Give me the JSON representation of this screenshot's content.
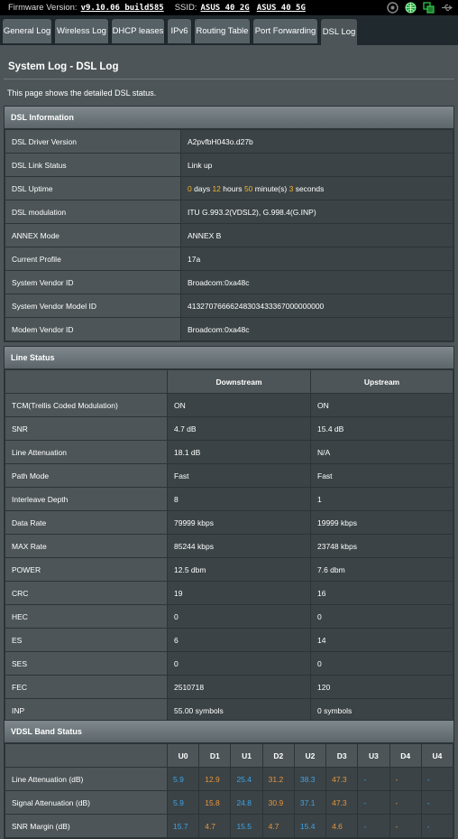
{
  "topbar": {
    "firmware_label": "Firmware Version:",
    "firmware_value": "v9.10.06 build585",
    "ssid_label": "SSID:",
    "ssid_2g": "ASUS_40_2G",
    "ssid_5g": "ASUS_40_5G"
  },
  "tabs": [
    {
      "label": "General Log"
    },
    {
      "label": "Wireless Log"
    },
    {
      "label": "DHCP leases"
    },
    {
      "label": "IPv6"
    },
    {
      "label": "Routing Table"
    },
    {
      "label": "Port Forwarding"
    },
    {
      "label": "DSL Log"
    }
  ],
  "page": {
    "title": "System Log - DSL Log",
    "description": "This page shows the detailed DSL status."
  },
  "dsl_info": {
    "header": "DSL Information",
    "rows": [
      {
        "label": "DSL Driver Version",
        "value": "A2pvfbH043o.d27b"
      },
      {
        "label": "DSL Link Status",
        "value": "Link up"
      },
      {
        "label": "DSL Uptime",
        "value": ""
      },
      {
        "label": "DSL modulation",
        "value": "ITU G.993.2(VDSL2), G.998.4(G.INP)"
      },
      {
        "label": "ANNEX Mode",
        "value": "ANNEX B"
      },
      {
        "label": "Current Profile",
        "value": "17a"
      },
      {
        "label": "System Vendor ID",
        "value": "Broadcom:0xa48c"
      },
      {
        "label": "System Vendor Model ID",
        "value": "41327076666248303433367000000000"
      },
      {
        "label": "Modem Vendor ID",
        "value": "Broadcom:0xa48c"
      }
    ],
    "uptime": {
      "days": "0",
      "days_label": "days",
      "hours": "12",
      "hours_label": "hours",
      "minutes": "50",
      "minutes_label": "minute(s)",
      "seconds": "3",
      "seconds_label": "seconds"
    }
  },
  "line_status": {
    "header": "Line Status",
    "col_downstream": "Downstream",
    "col_upstream": "Upstream",
    "rows": [
      {
        "label": "TCM(Trellis Coded Modulation)",
        "down": "ON",
        "up": "ON"
      },
      {
        "label": "SNR",
        "down": "4.7 dB",
        "up": "15.4 dB"
      },
      {
        "label": "Line Attenuation",
        "down": "18.1 dB",
        "up": "N/A"
      },
      {
        "label": "Path Mode",
        "down": "Fast",
        "up": "Fast"
      },
      {
        "label": "Interleave Depth",
        "down": "8",
        "up": "1"
      },
      {
        "label": "Data Rate",
        "down": "79999 kbps",
        "up": "19999 kbps"
      },
      {
        "label": "MAX Rate",
        "down": "85244 kbps",
        "up": "23748 kbps"
      },
      {
        "label": "POWER",
        "down": "12.5 dbm",
        "up": "7.6 dbm"
      },
      {
        "label": "CRC",
        "down": "19",
        "up": "16"
      },
      {
        "label": "HEC",
        "down": "0",
        "up": "0"
      },
      {
        "label": "ES",
        "down": "6",
        "up": "14"
      },
      {
        "label": "SES",
        "down": "0",
        "up": "0"
      },
      {
        "label": "FEC",
        "down": "2510718",
        "up": "120"
      },
      {
        "label": "INP",
        "down": "55.00 symbols",
        "up": "0 symbols"
      }
    ]
  },
  "vdsl_band": {
    "header": "VDSL Band Status",
    "columns": [
      "U0",
      "D1",
      "U1",
      "D2",
      "U2",
      "D3",
      "U3",
      "D4",
      "U4"
    ],
    "rows": [
      {
        "label": "Line Attenuation (dB)",
        "values": [
          "5.9",
          "12.9",
          "25.4",
          "31.2",
          "38.3",
          "47.3",
          "-",
          "-",
          "-"
        ]
      },
      {
        "label": "Signal Attenuation (dB)",
        "values": [
          "5.9",
          "15.8",
          "24.8",
          "30.9",
          "37.1",
          "47.3",
          "-",
          "-",
          "-"
        ]
      },
      {
        "label": "SNR Margin (dB)",
        "values": [
          "15.7",
          "4.7",
          "15.5",
          "4.7",
          "15.4",
          "4.6",
          "-",
          "-",
          "-"
        ]
      }
    ]
  },
  "colors": {
    "upstream_value": "#3ea3e6",
    "downstream_value": "#e8953a",
    "uptime_number": "#f0b429"
  }
}
